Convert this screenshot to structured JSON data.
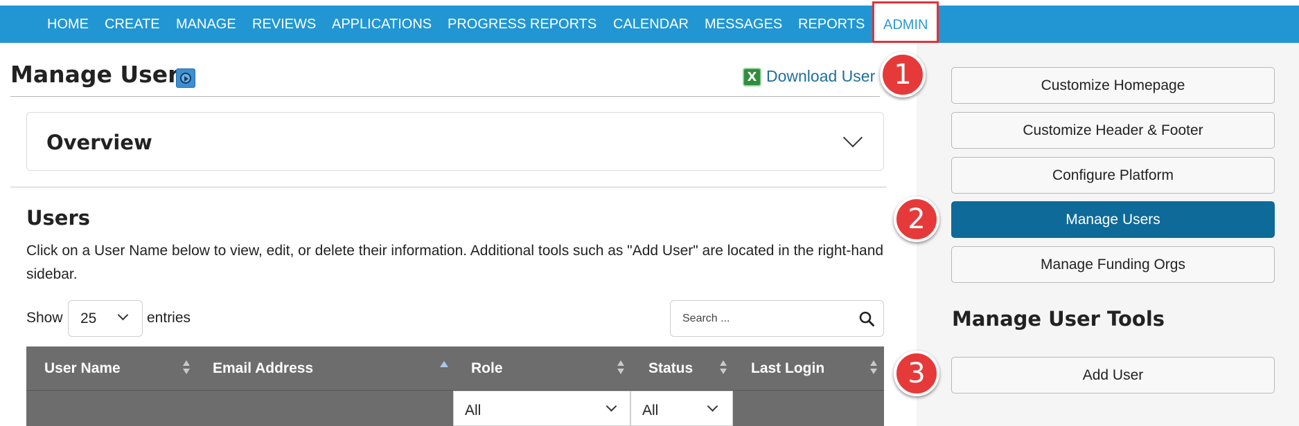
{
  "nav": {
    "items": [
      "HOME",
      "CREATE",
      "MANAGE",
      "REVIEWS",
      "APPLICATIONS",
      "PROGRESS REPORTS",
      "CALENDAR",
      "MESSAGES",
      "REPORTS",
      "ADMIN"
    ],
    "active": "ADMIN"
  },
  "page": {
    "title": "Manage Users",
    "download_label": "Download User L",
    "download_icon_glyph": "X"
  },
  "overview": {
    "title": "Overview"
  },
  "users": {
    "title": "Users",
    "description": "Click on a User Name below to view, edit, or delete their information. Additional tools such as \"Add User\" are located in the right-hand sidebar."
  },
  "controls": {
    "show_label": "Show",
    "entries_value": "25",
    "entries_label": "entries",
    "search_placeholder": "Search ..."
  },
  "table": {
    "columns": [
      "User Name",
      "Email Address",
      "Role",
      "Status",
      "Last Login"
    ],
    "filters": {
      "role": "All",
      "status": "All"
    }
  },
  "sidebar": {
    "buttons": [
      "Customize Homepage",
      "Customize Header & Footer",
      "Configure Platform",
      "Manage Users",
      "Manage Funding Orgs"
    ],
    "active": "Manage Users",
    "tools_title": "Manage User Tools",
    "tools_buttons": [
      "Add User"
    ]
  },
  "callouts": [
    "1",
    "2",
    "3"
  ],
  "colors": {
    "nav_bg": "#2196d3",
    "active_sidebar": "#0e6a98",
    "callout": "#e63a3a",
    "table_header": "#6d6d6d"
  }
}
